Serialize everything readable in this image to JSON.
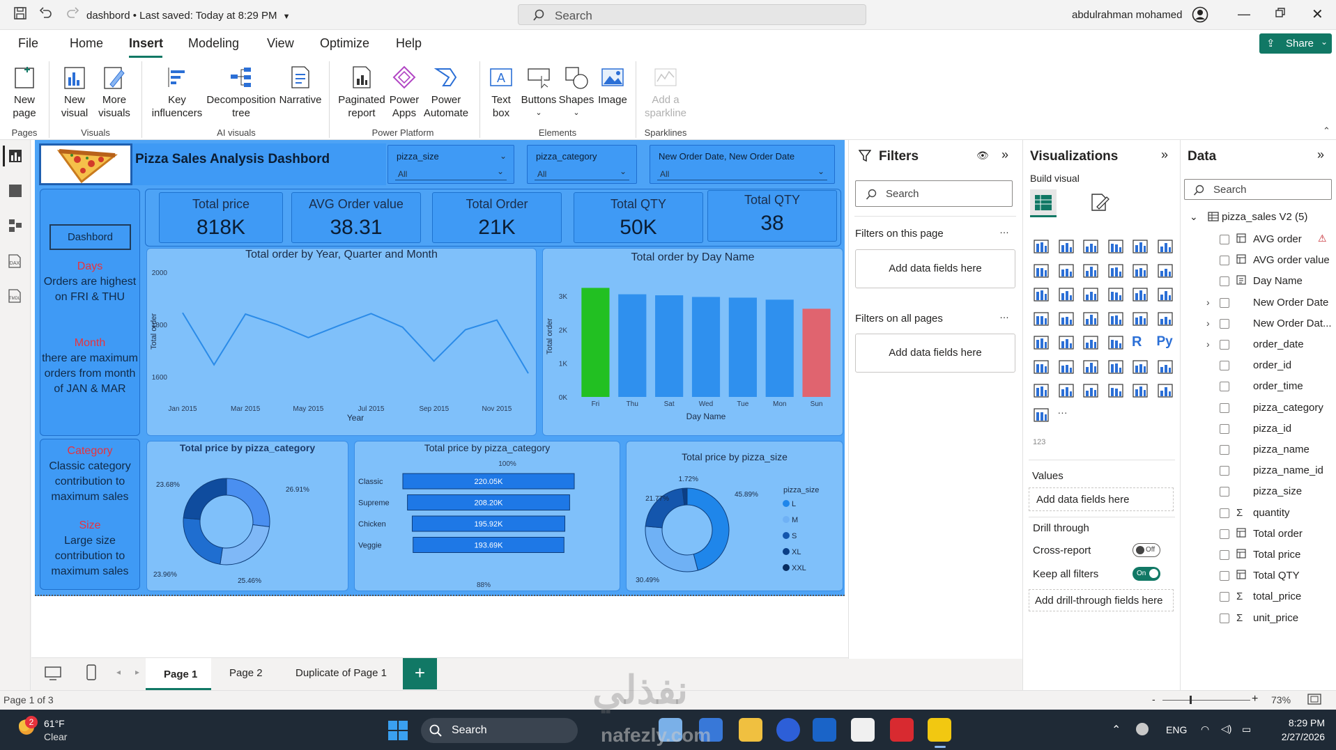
{
  "titlebar": {
    "file": "dashbord",
    "saved": "Last saved: Today at 8:29 PM",
    "search": "Search",
    "user": "abdulrahman mohamed"
  },
  "menu": [
    "File",
    "Home",
    "Insert",
    "Modeling",
    "View",
    "Optimize",
    "Help"
  ],
  "share": "Share",
  "ribbon": {
    "new_page": "New\npage",
    "new_visual": "New\nvisual",
    "more_visuals": "More\nvisuals",
    "key_influencers": "Key\ninfluencers",
    "decomp": "Decomposition\ntree",
    "narrative": "Narrative",
    "paginated": "Paginated\nreport",
    "power_apps": "Power\nApps",
    "power_automate": "Power\nAutomate",
    "text_box": "Text\nbox",
    "buttons": "Buttons",
    "shapes": "Shapes",
    "image": "Image",
    "sparkline": "Add a\nsparkline",
    "groups": {
      "pages": "Pages",
      "visuals": "Visuals",
      "ai": "AI visuals",
      "pp": "Power Platform",
      "elements": "Elements",
      "spark": "Sparklines"
    }
  },
  "dashboard": {
    "title": "Pizza Sales Analysis Dashbord",
    "slicers": [
      {
        "label": "pizza_size",
        "value": "All"
      },
      {
        "label": "pizza_category",
        "value": "All"
      },
      {
        "label": "New Order Date, New Order Date",
        "value": "All"
      }
    ],
    "nav_button": "Dashbord",
    "kpis": [
      {
        "title": "Total price",
        "value": "818K"
      },
      {
        "title": "AVG Order value",
        "value": "38.31"
      },
      {
        "title": "Total Order",
        "value": "21K"
      },
      {
        "title": "Total QTY",
        "value": "50K"
      },
      {
        "title": "Total QTY",
        "value": "38"
      }
    ],
    "insights": [
      {
        "heading": "Days",
        "text": "Orders are highest on FRI & THU"
      },
      {
        "heading": "Month",
        "text": "there are maximum orders from month of JAN & MAR"
      },
      {
        "heading": "Category",
        "text": "Classic category contribution to maximum sales"
      },
      {
        "heading": "Size",
        "text": "Large size contribution to maximum sales"
      }
    ],
    "colors": {
      "bg": "#4da3f6",
      "panel": "#7fc0fa",
      "kpi": "#3f9af5",
      "line": "#2b8be8",
      "max": "#22c022",
      "min": "#e0646f",
      "red": "#e8323c"
    }
  },
  "chart_data": [
    {
      "type": "line",
      "title": "Total order by Year, Quarter and Month",
      "xlabel": "Year",
      "ylabel": "Total order",
      "x": [
        "Jan 2015",
        "Feb 2015",
        "Mar 2015",
        "Apr 2015",
        "May 2015",
        "Jun 2015",
        "Jul 2015",
        "Aug 2015",
        "Sep 2015",
        "Oct 2015",
        "Nov 2015",
        "Dec 2015"
      ],
      "x_ticks": [
        "Jan 2015",
        "Mar 2015",
        "May 2015",
        "Jul 2015",
        "Sep 2015",
        "Nov 2015"
      ],
      "values": [
        1845,
        1646,
        1840,
        1800,
        1750,
        1797,
        1842,
        1790,
        1660,
        1780,
        1817,
        1613
      ],
      "ylim": [
        1560,
        2040
      ],
      "y_ticks": [
        1600,
        1800,
        2000
      ]
    },
    {
      "type": "bar",
      "title": "Total order by Day Name",
      "xlabel": "Day Name",
      "ylabel": "Total order",
      "categories": [
        "Fri",
        "Thu",
        "Sat",
        "Wed",
        "Tue",
        "Mon",
        "Sun"
      ],
      "values": [
        3240,
        3050,
        3020,
        2970,
        2950,
        2890,
        2620
      ],
      "ylim": [
        0,
        3600
      ],
      "y_ticks": [
        "0K",
        "1K",
        "2K",
        "3K"
      ]
    },
    {
      "type": "pie",
      "title": "Total price by pizza_category",
      "labels": [
        "Classic",
        "Supreme",
        "Chicken",
        "Veggie"
      ],
      "values": [
        26.91,
        25.46,
        23.96,
        23.68
      ]
    },
    {
      "type": "bar",
      "title": "Total price by pizza_category",
      "orientation": "horizontal",
      "categories": [
        "Classic",
        "Supreme",
        "Chicken",
        "Veggie"
      ],
      "values": [
        220.05,
        208.2,
        195.92,
        193.69
      ],
      "data_labels": [
        "220.05K",
        "208.20K",
        "195.92K",
        "193.69K"
      ],
      "top_label": "100%",
      "bottom_label": "88%"
    },
    {
      "type": "pie",
      "title": "Total price by pizza_size",
      "legend_title": "pizza_size",
      "labels": [
        "L",
        "M",
        "S",
        "XL",
        "XXL"
      ],
      "values": [
        45.89,
        30.49,
        21.77,
        1.72,
        0.12
      ],
      "value_labels": [
        "45.89%",
        "30.49%",
        "21.77%",
        "1.72%"
      ]
    }
  ],
  "filters": {
    "title": "Filters",
    "search": "Search",
    "this_page": "Filters on this page",
    "all_pages": "Filters on all pages",
    "add": "Add data fields here"
  },
  "viz": {
    "title": "Visualizations",
    "build": "Build visual",
    "values": "Values",
    "add": "Add data fields here",
    "drill": "Drill through",
    "cross": "Cross-report",
    "cross_state": "Off",
    "keep": "Keep all filters",
    "keep_state": "On",
    "add_drill": "Add drill-through fields here"
  },
  "data_pane": {
    "title": "Data",
    "search": "Search",
    "table": "pizza_sales V2 (5)",
    "fields": [
      {
        "name": "AVG order",
        "icon": "calc",
        "warn": true,
        "expand": false
      },
      {
        "name": "AVG order value",
        "icon": "calc",
        "warn": false,
        "expand": false
      },
      {
        "name": "Day Name",
        "icon": "hier",
        "warn": false,
        "expand": false
      },
      {
        "name": "New Order Date",
        "icon": "",
        "warn": false,
        "expand": true
      },
      {
        "name": "New Order Dat...",
        "icon": "",
        "warn": false,
        "expand": true
      },
      {
        "name": "order_date",
        "icon": "",
        "warn": false,
        "expand": true
      },
      {
        "name": "order_id",
        "icon": "",
        "warn": false,
        "expand": false
      },
      {
        "name": "order_time",
        "icon": "",
        "warn": false,
        "expand": false
      },
      {
        "name": "pizza_category",
        "icon": "",
        "warn": false,
        "expand": false
      },
      {
        "name": "pizza_id",
        "icon": "",
        "warn": false,
        "expand": false
      },
      {
        "name": "pizza_name",
        "icon": "",
        "warn": false,
        "expand": false
      },
      {
        "name": "pizza_name_id",
        "icon": "",
        "warn": false,
        "expand": false
      },
      {
        "name": "pizza_size",
        "icon": "",
        "warn": false,
        "expand": false
      },
      {
        "name": "quantity",
        "icon": "sum",
        "warn": false,
        "expand": false
      },
      {
        "name": "Total order",
        "icon": "calc",
        "warn": false,
        "expand": false
      },
      {
        "name": "Total price",
        "icon": "calc",
        "warn": false,
        "expand": false
      },
      {
        "name": "Total QTY",
        "icon": "calc",
        "warn": false,
        "expand": false
      },
      {
        "name": "total_price",
        "icon": "sum",
        "warn": false,
        "expand": false
      },
      {
        "name": "unit_price",
        "icon": "sum",
        "warn": false,
        "expand": false
      }
    ]
  },
  "tabs": [
    "Page 1",
    "Page 2",
    "Duplicate of Page 1"
  ],
  "status": {
    "page": "Page 1 of 3",
    "zoom": "73%"
  },
  "taskbar": {
    "temp": "61°F",
    "weather": "Clear",
    "badge": "2",
    "search": "Search",
    "lang": "ENG",
    "time": "8:29 PM",
    "date": "2/27/2026",
    "watermark": "نفذلي",
    "watermark2": "nafezly.com"
  }
}
